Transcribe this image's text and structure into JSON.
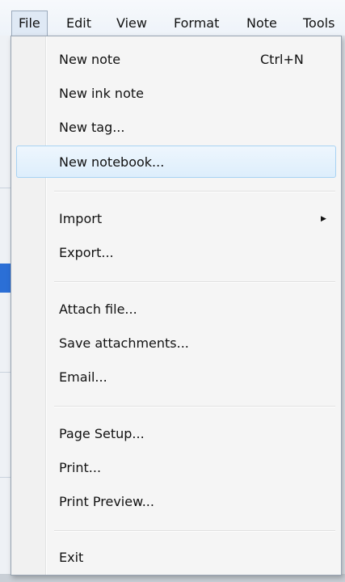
{
  "menubar": {
    "items": [
      {
        "label": "File",
        "active": true
      },
      {
        "label": "Edit"
      },
      {
        "label": "View"
      },
      {
        "label": "Format"
      },
      {
        "label": "Note"
      },
      {
        "label": "Tools"
      }
    ]
  },
  "file_menu": {
    "items": [
      {
        "label": "New note",
        "shortcut": "Ctrl+N"
      },
      {
        "label": "New ink note"
      },
      {
        "label": "New tag..."
      },
      {
        "label": "New notebook...",
        "highlighted": true
      },
      {
        "label": "Import",
        "has_submenu": true
      },
      {
        "label": "Export..."
      },
      {
        "label": "Attach file..."
      },
      {
        "label": "Save attachments..."
      },
      {
        "label": "Email..."
      },
      {
        "label": "Page Setup..."
      },
      {
        "label": "Print..."
      },
      {
        "label": "Print Preview..."
      },
      {
        "label": "Exit"
      }
    ]
  },
  "colors": {
    "highlight_border": "#a8d2f2",
    "highlight_fill": "#ddeefc",
    "menu_background": "#f5f5f5"
  }
}
